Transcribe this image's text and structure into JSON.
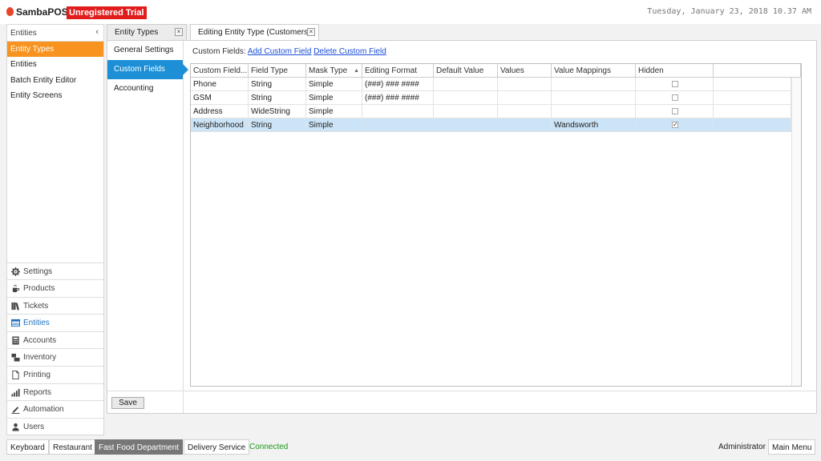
{
  "app": {
    "name": "SambaPOS",
    "trial_badge": "Unregistered Trial",
    "datetime": "Tuesday, January 23, 2018 10.37 AM"
  },
  "nav": {
    "header": "Entities",
    "collapse_glyph": "‹",
    "items": [
      {
        "label": "Entity Types",
        "active": true
      },
      {
        "label": "Entities"
      },
      {
        "label": "Batch Entity Editor"
      },
      {
        "label": "Entity Screens"
      }
    ],
    "modules": [
      {
        "label": "Settings",
        "icon": "gear-icon"
      },
      {
        "label": "Products",
        "icon": "coffee-icon"
      },
      {
        "label": "Tickets",
        "icon": "books-icon"
      },
      {
        "label": "Entities",
        "icon": "table-icon",
        "active": true
      },
      {
        "label": "Accounts",
        "icon": "calculator-icon"
      },
      {
        "label": "Inventory",
        "icon": "boxes-icon"
      },
      {
        "label": "Printing",
        "icon": "document-icon"
      },
      {
        "label": "Reports",
        "icon": "bar-chart-icon"
      },
      {
        "label": "Automation",
        "icon": "pen-icon"
      },
      {
        "label": "Users",
        "icon": "user-icon"
      }
    ]
  },
  "tabs": [
    {
      "label": "Entity Types",
      "close": "×"
    },
    {
      "label": "Editing Entity Type (Customers)",
      "close": "×",
      "active": true
    }
  ],
  "side_tabs": [
    {
      "label": "General Settings"
    },
    {
      "label": "Custom Fields",
      "active": true
    },
    {
      "label": "Accounting"
    }
  ],
  "custom_fields": {
    "label": "Custom Fields:",
    "add_link": "Add Custom Field",
    "delete_link": "Delete Custom Field"
  },
  "grid": {
    "columns": [
      "Custom Field...",
      "Field Type",
      "Mask Type",
      "Editing Format",
      "Default Value",
      "Values",
      "Value Mappings",
      "Hidden"
    ],
    "sort_glyph": "▲",
    "rows": [
      {
        "name": "Phone",
        "type": "String",
        "mask": "Simple",
        "format": "(###) ### ####",
        "default": "",
        "values": "",
        "mappings": "",
        "hidden": false
      },
      {
        "name": "GSM",
        "type": "String",
        "mask": "Simple",
        "format": "(###) ### ####",
        "default": "",
        "values": "",
        "mappings": "",
        "hidden": false
      },
      {
        "name": "Address",
        "type": "WideString",
        "mask": "Simple",
        "format": "",
        "default": "",
        "values": "",
        "mappings": "",
        "hidden": false
      },
      {
        "name": "Neighborhood",
        "type": "String",
        "mask": "Simple",
        "format": "",
        "default": "",
        "values": "",
        "mappings": "Wandsworth",
        "hidden": true,
        "selected": true
      }
    ],
    "check_glyph": "✓"
  },
  "save_label": "Save",
  "bottom": {
    "buttons": [
      "Keyboard",
      "Restaurant",
      "Fast Food Department",
      "Delivery Service"
    ],
    "active_button": "Fast Food Department",
    "status": "Connected",
    "user": "Administrator",
    "main_menu": "Main Menu"
  },
  "colors": {
    "accent_orange": "#f7931e",
    "accent_blue": "#1c8fd6",
    "trial_red": "#e01c1c",
    "connected_green": "#1a9a1a"
  }
}
